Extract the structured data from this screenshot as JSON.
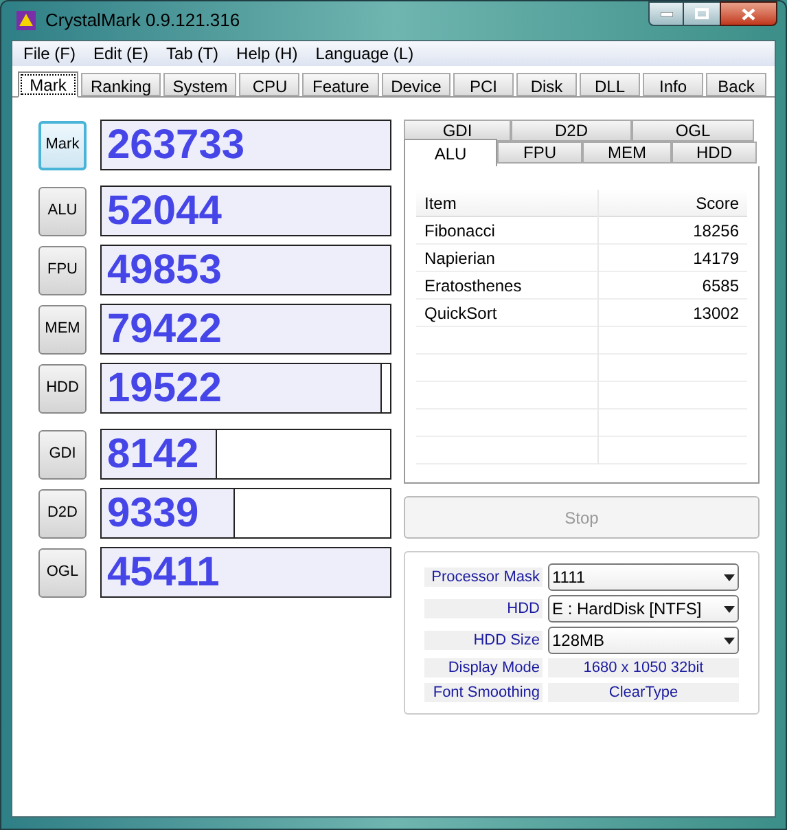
{
  "window": {
    "title": "CrystalMark 0.9.121.316"
  },
  "menu": [
    "File (F)",
    "Edit (E)",
    "Tab (T)",
    "Help (H)",
    "Language (L)"
  ],
  "tabs": [
    {
      "label": "Mark",
      "selected": true
    },
    {
      "label": "Ranking",
      "selected": false
    },
    {
      "label": "System",
      "selected": false
    },
    {
      "label": "CPU",
      "selected": false
    },
    {
      "label": "Feature",
      "selected": false
    },
    {
      "label": "Device",
      "selected": false
    },
    {
      "label": "PCI",
      "selected": false
    },
    {
      "label": "Disk",
      "selected": false
    },
    {
      "label": "DLL",
      "selected": false
    },
    {
      "label": "Info",
      "selected": false
    },
    {
      "label": "Back",
      "selected": false
    }
  ],
  "score_groups": [
    [
      {
        "label": "Mark",
        "value": "263733",
        "level": 1,
        "selected": true
      }
    ],
    [
      {
        "label": "ALU",
        "value": "52044",
        "level": 1,
        "selected": false
      },
      {
        "label": "FPU",
        "value": "49853",
        "level": 1,
        "selected": false
      },
      {
        "label": "MEM",
        "value": "79422",
        "level": 1,
        "selected": false
      },
      {
        "label": "HDD",
        "value": "19522",
        "level": 0.97,
        "selected": false
      }
    ],
    [
      {
        "label": "GDI",
        "value": "8142",
        "level": 0.4,
        "selected": false
      },
      {
        "label": "D2D",
        "value": "9339",
        "level": 0.46,
        "selected": false
      },
      {
        "label": "OGL",
        "value": "45411",
        "level": 1,
        "selected": false
      }
    ]
  ],
  "subtabs_back": [
    {
      "label": "GDI",
      "selected": false
    },
    {
      "label": "D2D",
      "selected": false
    },
    {
      "label": "OGL",
      "selected": false
    }
  ],
  "subtabs_front": [
    {
      "label": "ALU",
      "selected": true
    },
    {
      "label": "FPU",
      "selected": false
    },
    {
      "label": "MEM",
      "selected": false
    },
    {
      "label": "HDD",
      "selected": false
    }
  ],
  "table": {
    "columns": [
      "Item",
      "Score"
    ],
    "rows": [
      [
        "Fibonacci",
        "18256"
      ],
      [
        "Napierian",
        "14179"
      ],
      [
        "Eratosthenes",
        "6585"
      ],
      [
        "QuickSort",
        "13002"
      ]
    ]
  },
  "stop_button": {
    "label": "Stop",
    "disabled": true
  },
  "settings": [
    {
      "kind": "dropdown",
      "label": "Processor Mask",
      "value": "1111"
    },
    {
      "kind": "dropdown",
      "label": "HDD",
      "value": "E : HardDisk [NTFS]"
    },
    {
      "kind": "dropdown",
      "label": "HDD Size",
      "value": "128MB"
    },
    {
      "kind": "info",
      "label": "Display Mode",
      "value": "1680 x 1050 32bit"
    },
    {
      "kind": "info",
      "label": "Font Smoothing",
      "value": "ClearType"
    }
  ]
}
